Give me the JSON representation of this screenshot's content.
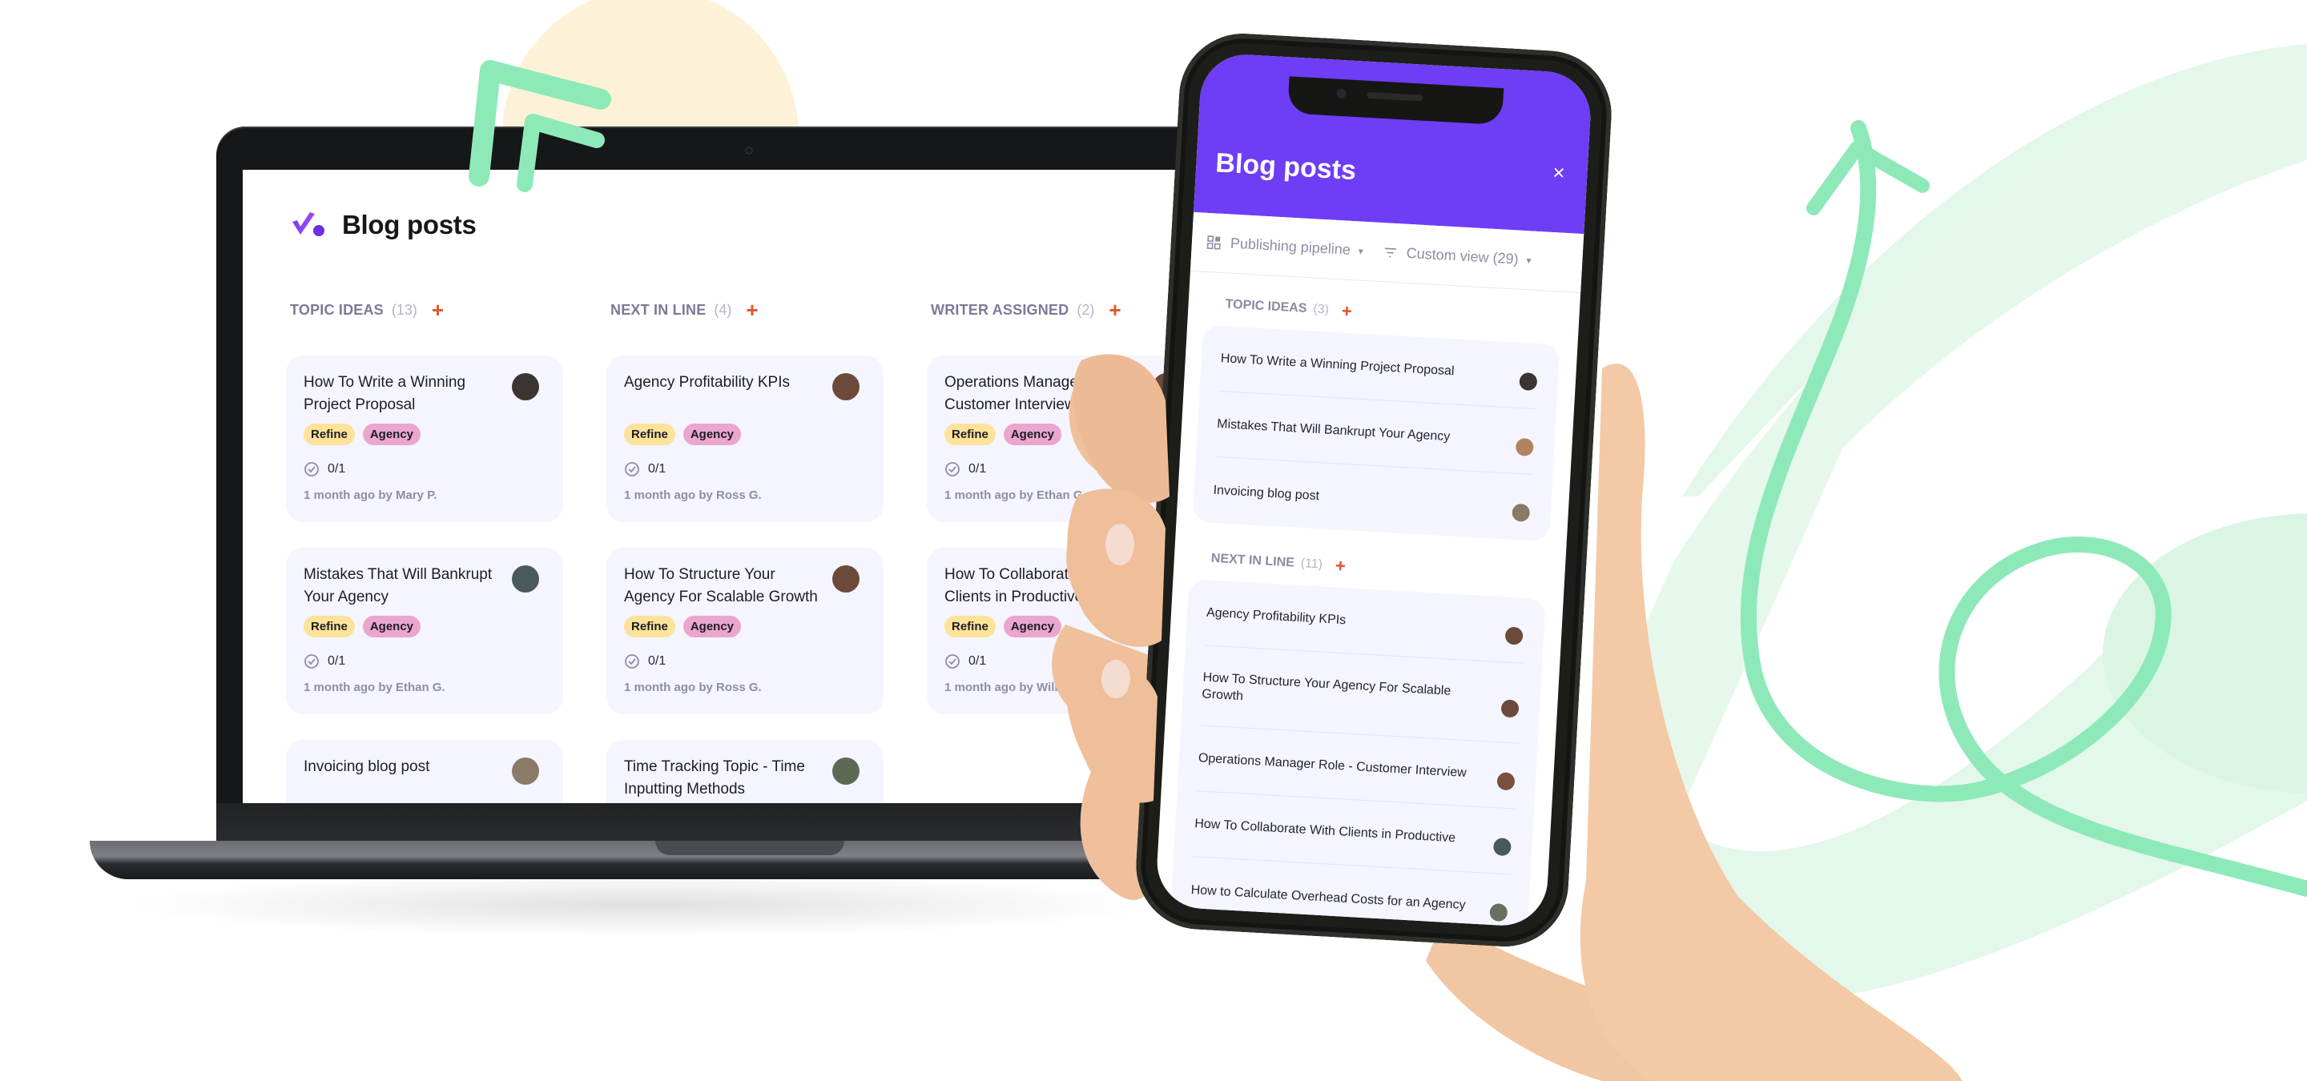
{
  "laptop_app": {
    "title": "Blog posts",
    "logo_icon": "productive-check-logo",
    "columns": [
      {
        "name": "TOPIC IDEAS",
        "count": "(13)",
        "add_label": "+",
        "cards": [
          {
            "title": "How To Write a Winning Project Proposal",
            "tags": [
              "Refine",
              "Agency"
            ],
            "checklist": "0/1",
            "meta": "1 month ago by Mary P.",
            "avatar_color": "#3b3431"
          },
          {
            "title": "Mistakes That Will Bankrupt Your Agency",
            "tags": [
              "Refine",
              "Agency"
            ],
            "checklist": "0/1",
            "meta": "1 month ago by Ethan G.",
            "avatar_color": "#4a5a5c"
          },
          {
            "title": "Invoicing blog post",
            "tags": [],
            "checklist": "",
            "meta": "",
            "avatar_color": "#8a7a66"
          }
        ]
      },
      {
        "name": "NEXT IN LINE",
        "count": "(4)",
        "add_label": "+",
        "cards": [
          {
            "title": "Agency Profitability KPIs",
            "tags": [
              "Refine",
              "Agency"
            ],
            "checklist": "0/1",
            "meta": "1 month ago by Ross G.",
            "avatar_color": "#6b4a3a"
          },
          {
            "title": "How To Structure Your Agency For Scalable Growth",
            "tags": [
              "Refine",
              "Agency"
            ],
            "checklist": "0/1",
            "meta": "1 month ago by Ross G.",
            "avatar_color": "#6b4a3a"
          },
          {
            "title": "Time Tracking Topic - Time Inputting Methods",
            "tags": [],
            "checklist": "",
            "meta": "",
            "avatar_color": "#5c6a55"
          }
        ]
      },
      {
        "name": "WRITER ASSIGNED",
        "count": "(2)",
        "add_label": "+",
        "cards": [
          {
            "title": "Operations Manager Role - Customer Interview",
            "tags": [
              "Refine",
              "Agency"
            ],
            "checklist": "0/1",
            "meta": "1 month ago by Ethan G.",
            "avatar_color": "#6b4a3a"
          },
          {
            "title": "How To Collaborate With Clients in Productive",
            "tags": [
              "Refine",
              "Agency"
            ],
            "checklist": "0/1",
            "meta": "1 month ago by William",
            "avatar_color": "#4a5a5c"
          }
        ]
      }
    ]
  },
  "phone_app": {
    "title": "Blog posts",
    "close_label": "×",
    "toolbar": {
      "pipeline_label": "Publishing pipeline",
      "view_label": "Custom view (29)",
      "caret": "▾"
    },
    "sections": [
      {
        "name": "TOPIC IDEAS",
        "count": "(3)",
        "add_label": "+",
        "rows": [
          {
            "title": "How To Write a Winning Project Proposal",
            "avatar_color": "#3b3431"
          },
          {
            "title": "Mistakes That Will Bankrupt Your Agency",
            "avatar_color": "#b08460"
          },
          {
            "title": "Invoicing blog post",
            "avatar_color": "#8a7a66"
          }
        ]
      },
      {
        "name": "NEXT IN LINE",
        "count": "(11)",
        "add_label": "+",
        "rows": [
          {
            "title": "Agency Profitability KPIs",
            "avatar_color": "#6b4a3a"
          },
          {
            "title": "How To Structure Your Agency For Scalable Growth",
            "avatar_color": "#6b4a3a"
          },
          {
            "title": "Operations Manager Role - Customer Interview",
            "avatar_color": "#7a4f3e"
          },
          {
            "title": "How To Collaborate With Clients in Productive",
            "avatar_color": "#4a5a5c"
          },
          {
            "title": "How to Calculate Overhead Costs for an Agency",
            "avatar_color": "#6a7060"
          }
        ]
      }
    ]
  },
  "colors": {
    "brand_purple": "#6e3df6",
    "accent_orange": "#e0562b",
    "tag_refine": "#fde39a",
    "tag_agency": "#eaa6cc",
    "card_bg": "#f4f5fe",
    "deco_green": "#8ee9b9",
    "deco_green_light": "#e3f7ea",
    "deco_cream": "#fdf1d8"
  }
}
